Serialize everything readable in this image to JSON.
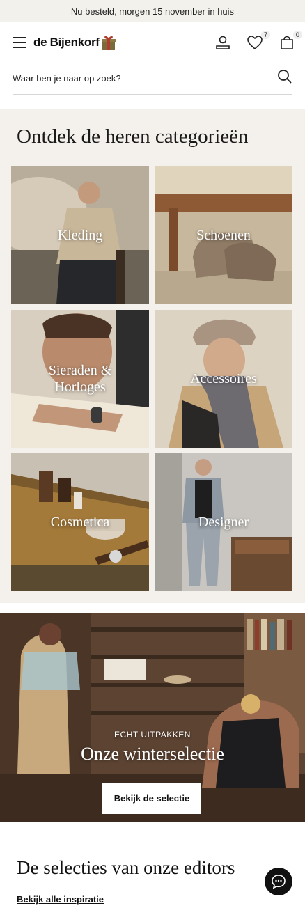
{
  "announcement": "Nu besteld, morgen 15 november in huis",
  "header": {
    "logo_text": "de Bijenkorf",
    "wishlist_count": "7",
    "cart_count": "0",
    "icons": [
      "menu-icon",
      "account-icon",
      "heart-icon",
      "bag-icon"
    ]
  },
  "search": {
    "placeholder": "Waar ben je naar op zoek?"
  },
  "categories": {
    "title": "Ontdek de heren categorieën",
    "items": [
      {
        "label": "Kleding"
      },
      {
        "label": "Schoenen"
      },
      {
        "label": "Sieraden & Horloges"
      },
      {
        "label": "Accessoires"
      },
      {
        "label": "Cosmetica"
      },
      {
        "label": "Designer"
      }
    ]
  },
  "banner": {
    "eyebrow": "ECHT UITPAKKEN",
    "headline": "Onze winterselectie",
    "cta": "Bekijk de selectie"
  },
  "editors": {
    "title": "De selecties van onze editors",
    "link": "Bekijk alle inspiratie"
  },
  "colors": {
    "section_bg": "#f4f1ec",
    "topbar_bg": "#f3f1ec",
    "text": "#111111"
  }
}
